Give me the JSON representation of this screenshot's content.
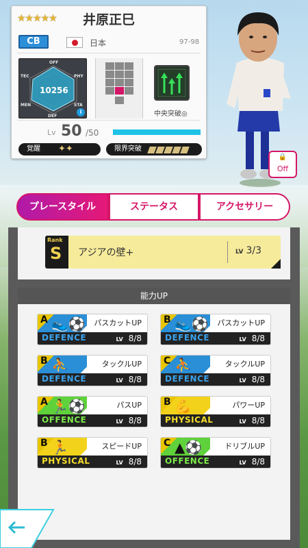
{
  "player": {
    "stars": "★★★★★",
    "name": "井原正巳",
    "position": "CB",
    "country": "日本",
    "season": "97-98",
    "rating": "10256",
    "radar_labels": {
      "off": "OFF",
      "tec": "TEC",
      "phy": "PHY",
      "men": "MEN",
      "sta": "STA",
      "def": "DEF"
    },
    "tactic_label": "中央突破◎",
    "level_label": "Lv",
    "level": "50",
    "level_max": "/50",
    "level_progress": 1.0,
    "awakening_label": "覚醒",
    "awakening_marks": "✦✦",
    "limit_break_label": "限界突破",
    "limit_break_count": 5
  },
  "avatar_toggle": {
    "label": "Off"
  },
  "tabs": [
    {
      "label": "プレースタイル",
      "active": true
    },
    {
      "label": "ステータス",
      "active": false
    },
    {
      "label": "アクセサリー",
      "active": false
    }
  ],
  "skill": {
    "rank_label": "Rank",
    "rank": "S",
    "name": "アジアの壁+",
    "lv_label": "LV",
    "lv": "3",
    "lv_max": "/3"
  },
  "abilities_header": "能力UP",
  "abilities": [
    {
      "grade": "A",
      "name": "パスカットUP",
      "category": "DEFENCE",
      "lv_label": "LV",
      "lv": "8/8",
      "kind": "def",
      "icon": "soccer-boot-icon"
    },
    {
      "grade": "B",
      "name": "パスカットUP",
      "category": "DEFENCE",
      "lv_label": "LV",
      "lv": "8/8",
      "kind": "def",
      "icon": "soccer-boot-icon"
    },
    {
      "grade": "B",
      "name": "タックルUP",
      "category": "DEFENCE",
      "lv_label": "LV",
      "lv": "8/8",
      "kind": "def",
      "icon": "tackle-icon"
    },
    {
      "grade": "C",
      "name": "タックルUP",
      "category": "DEFENCE",
      "lv_label": "LV",
      "lv": "8/8",
      "kind": "def",
      "icon": "tackle-icon"
    },
    {
      "grade": "A",
      "name": "パスUP",
      "category": "OFFENCE",
      "lv_label": "LV",
      "lv": "8/8",
      "kind": "off",
      "icon": "pass-icon"
    },
    {
      "grade": "B",
      "name": "パワーUP",
      "category": "PHYSICAL",
      "lv_label": "LV",
      "lv": "8/8",
      "kind": "phy",
      "icon": "muscle-icon"
    },
    {
      "grade": "B",
      "name": "スピードUP",
      "category": "PHYSICAL",
      "lv_label": "LV",
      "lv": "8/8",
      "kind": "phy",
      "icon": "runner-icon"
    },
    {
      "grade": "C",
      "name": "ドリブルUP",
      "category": "OFFENCE",
      "lv_label": "LV",
      "lv": "8/8",
      "kind": "off",
      "icon": "dribble-icon"
    }
  ],
  "colors": {
    "accent": "#d51566",
    "defence": "#2a8fd6",
    "offence": "#5fd13b",
    "physical": "#f2d21a",
    "level_bar": "#1fc3e7"
  },
  "back_icon": "back-arrow-icon"
}
